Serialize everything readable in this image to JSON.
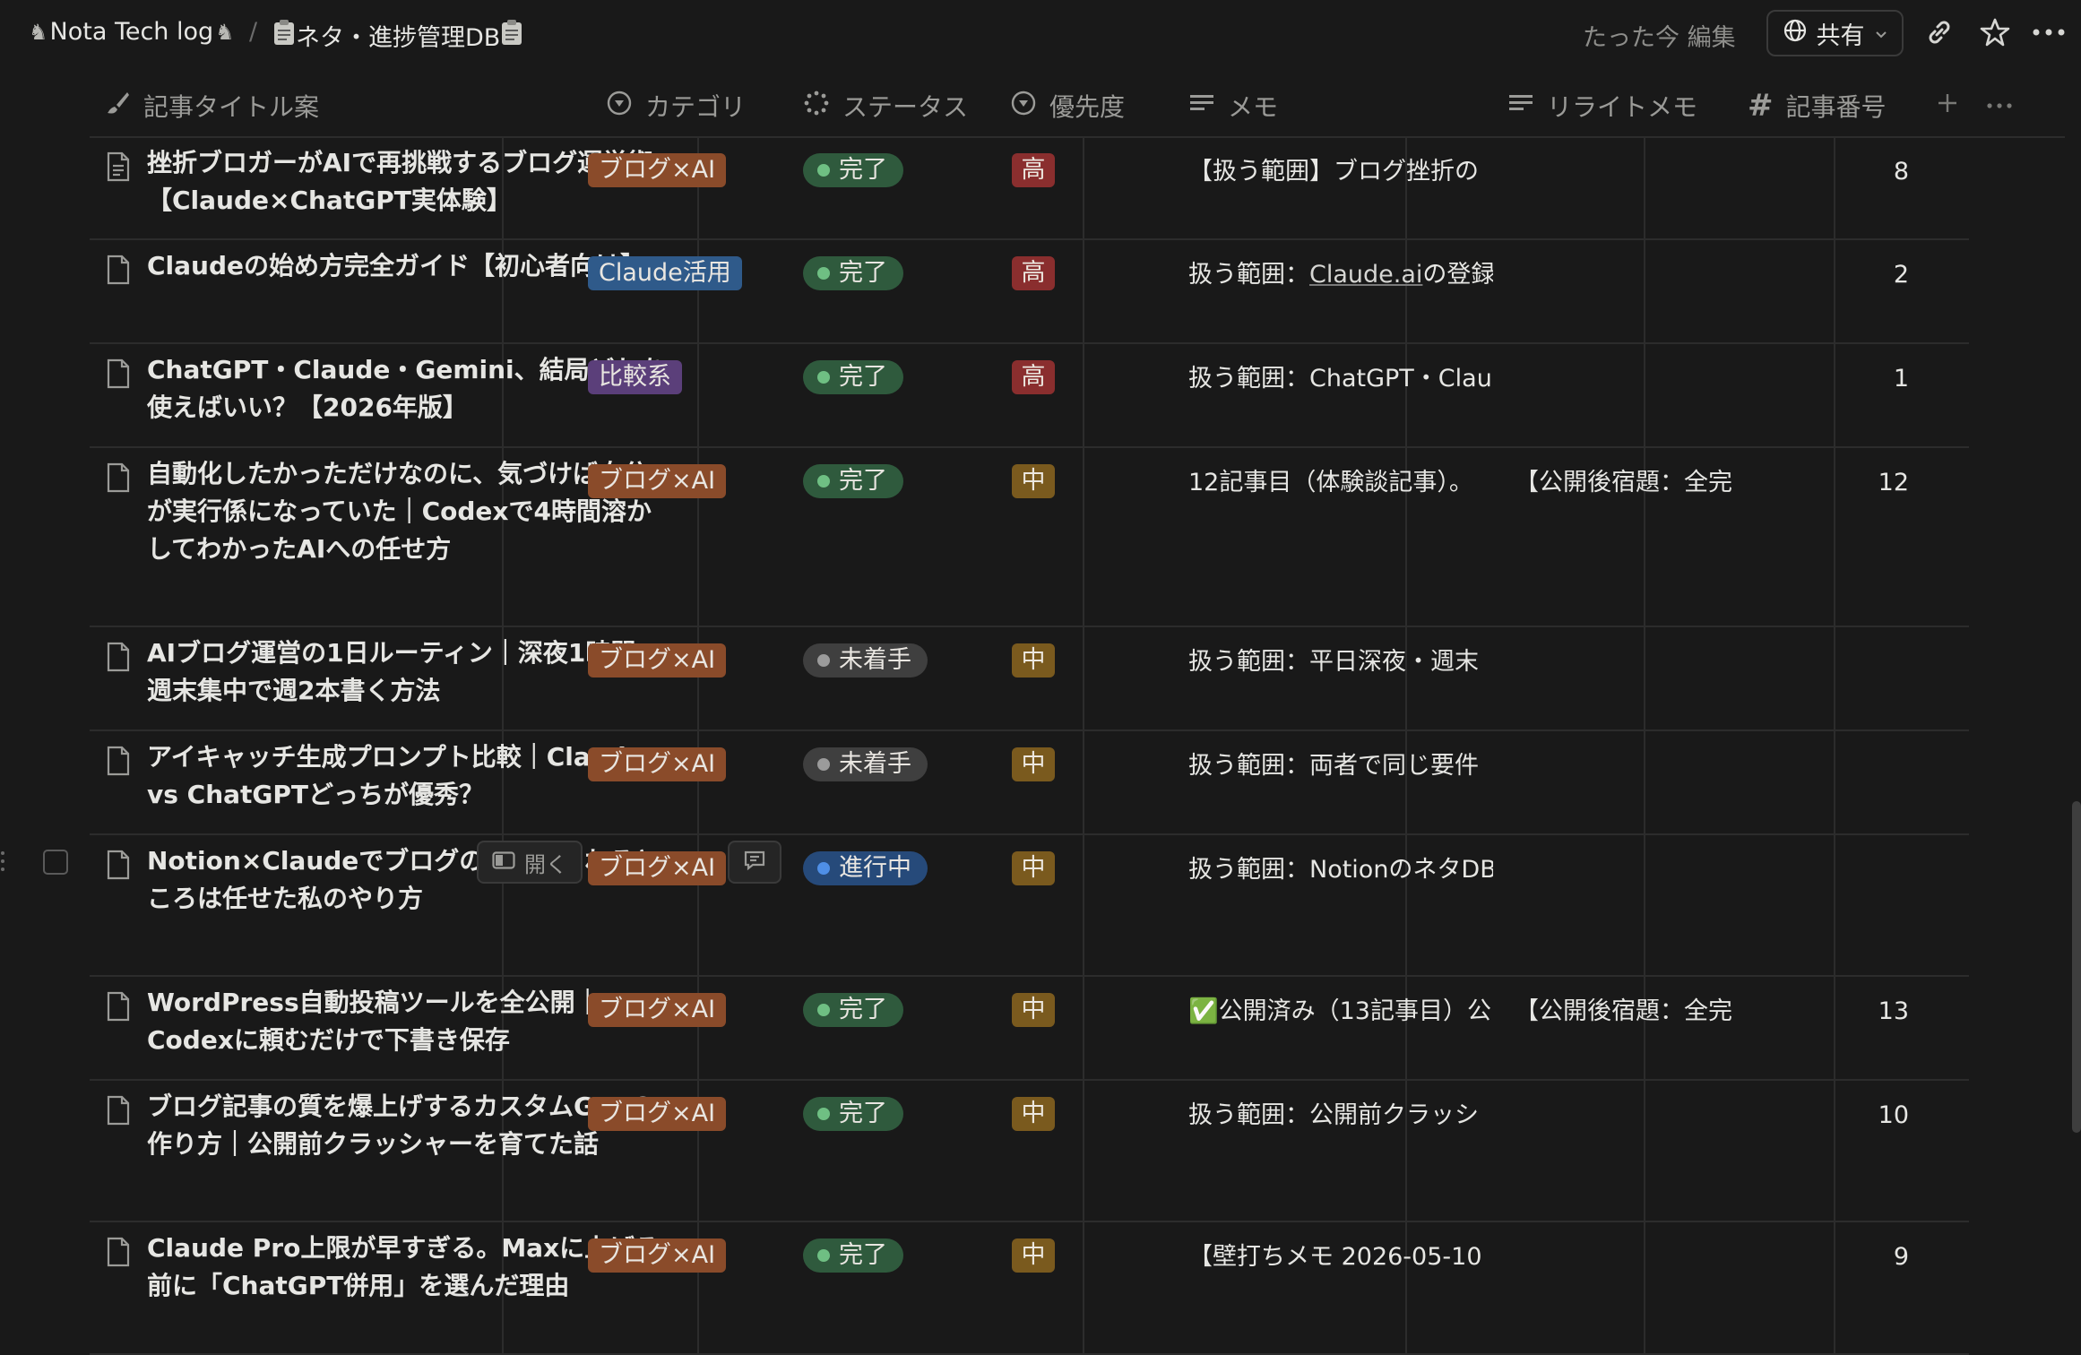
{
  "breadcrumb": {
    "workspace": "Nota Tech log",
    "page": "ネタ・進捗管理DB"
  },
  "topbar": {
    "edited": "たった今 編集",
    "share_label": "共有"
  },
  "columns": {
    "title": "記事タイトル案",
    "category": "カテゴリ",
    "status": "ステータス",
    "priority": "優先度",
    "memo": "メモ",
    "rewrite": "リライトメモ",
    "number": "記事番号"
  },
  "hover": {
    "open_label": "開く"
  },
  "colors": {
    "cat_blog_ai": "#8a4b2a",
    "cat_claude": "#2f5a8a",
    "cat_compare": "#5b3f7a",
    "status_done_bg": "#2f5a3d",
    "status_done_dot": "#6fbf83",
    "status_todo_bg": "#3f3f3f",
    "status_todo_dot": "#9b9b9b",
    "status_doing_bg": "#264a7a",
    "status_doing_dot": "#4f8fe6",
    "prio_high": "#8a2e2e",
    "prio_mid": "#7a5a1e"
  },
  "rows": [
    {
      "title": "挫折ブロガーがAIで再挑戦するブログ運営術【Claude×ChatGPT実体験】",
      "category": "ブログ×AI",
      "status": "完了",
      "priority": "高",
      "memo": "【扱う範囲】ブログ挫折の",
      "rewrite": "",
      "number": "8"
    },
    {
      "title": "Claudeの始め方完全ガイド【初心者向け】",
      "category": "Claude活用",
      "status": "完了",
      "priority": "高",
      "memo_prefix": "扱う範囲：",
      "memo_link": "Claude.ai",
      "memo_suffix": "の登録",
      "rewrite": "",
      "number": "2"
    },
    {
      "title": "ChatGPT・Claude・Gemini、結局どれを使えばいい？【2026年版】",
      "category": "比較系",
      "status": "完了",
      "priority": "高",
      "memo": "扱う範囲：ChatGPT・Clau",
      "rewrite": "",
      "number": "1"
    },
    {
      "title": "自動化したかっただけなのに、気づけば自分が実行係になっていた｜Codexで4時間溶かしてわかったAIへの任せ方",
      "category": "ブログ×AI",
      "status": "完了",
      "priority": "中",
      "memo": "12記事目（体験談記事）。",
      "rewrite": "【公開後宿題：全完",
      "number": "12"
    },
    {
      "title": "AIブログ運営の1日ルーティン｜深夜1時間×週末集中で週2本書く方法",
      "category": "ブログ×AI",
      "status": "未着手",
      "priority": "中",
      "memo": "扱う範囲：平日深夜・週末",
      "rewrite": "",
      "number": ""
    },
    {
      "title": "アイキャッチ生成プロンプト比較｜Claude vs ChatGPTどっちが優秀？",
      "category": "ブログ×AI",
      "status": "未着手",
      "priority": "中",
      "memo": "扱う範囲：両者で同じ要件",
      "rewrite": "",
      "number": ""
    },
    {
      "title": "Notion×Claudeでブログのネ任せられるところは任せた私のやり方",
      "category": "ブログ×AI",
      "status": "進行中",
      "priority": "中",
      "memo": "扱う範囲：NotionのネタDB",
      "rewrite": "",
      "number": ""
    },
    {
      "title": "WordPress自動投稿ツールを全公開｜Codexに頼むだけで下書き保存",
      "category": "ブログ×AI",
      "status": "完了",
      "priority": "中",
      "memo": "✅公開済み（13記事目）公",
      "rewrite": "【公開後宿題：全完",
      "number": "13"
    },
    {
      "title": "ブログ記事の質を爆上げするカスタムGPTの作り方｜公開前クラッシャーを育てた話",
      "category": "ブログ×AI",
      "status": "完了",
      "priority": "中",
      "memo": "扱う範囲：公開前クラッシ",
      "rewrite": "",
      "number": "10"
    },
    {
      "title": "Claude Pro上限が早すぎる。Maxに上げる前に「ChatGPT併用」を選んだ理由",
      "category": "ブログ×AI",
      "status": "完了",
      "priority": "中",
      "memo": "【壁打ちメモ 2026-05-10",
      "rewrite": "",
      "number": "9"
    }
  ]
}
